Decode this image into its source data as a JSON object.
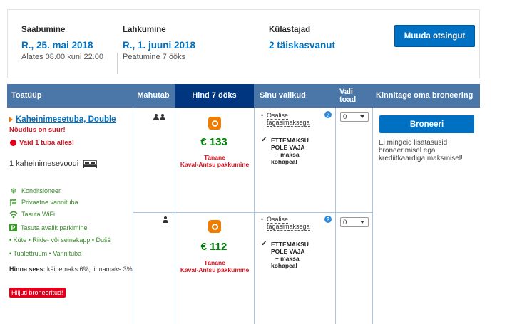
{
  "summary": {
    "checkin": {
      "label": "Saabumine",
      "value": "R., 25. mai 2018",
      "sub": "Alates 08.00 kuni 22.00"
    },
    "checkout": {
      "label": "Lahkumine",
      "value": "R., 1. juuni 2018",
      "sub": "Peatumine 7 ööks"
    },
    "guests": {
      "label": "Külastajad",
      "value": "2 täiskasvanut"
    },
    "change_button": "Muuda otsingut"
  },
  "table": {
    "headers": {
      "room_type": "Toatüüp",
      "capacity": "Mahutab",
      "price": "Hind 7 ööks",
      "choices": "Sinu valikud",
      "select_line1": "Vali",
      "select_line2": "toad",
      "confirm": "Kinnitage oma broneering"
    },
    "room": {
      "name": "Kaheinimesetuba, Double",
      "demand": "Nõudlus on suur!",
      "rooms_left": "Vaid 1 tuba alles!",
      "bed": "1 kaheinimesevoodi",
      "facilities": [
        "Konditsioneer",
        "Privaatne vannituba",
        "Tasuta WiFi",
        "Tasuta avalik parkimine"
      ],
      "amenities_line1": "• Küte • Riide- või seinakapp • Dušš",
      "amenities_line2": "• Tualettruum • Vannituba",
      "taxes_label": "Hinna sees:",
      "taxes_text": " käibemaks 6%, linnamaks 3%",
      "recent_badge": "Hiljuti broneeritud!"
    },
    "offers": [
      {
        "occupancy": 2,
        "price": "€ 133",
        "deal_line1": "Tänane",
        "deal_line2": "Kaval-Antsu pakkumine",
        "choice_line1": "Osalise",
        "choice_line2": "tagasimaksega",
        "prepay_line1": "ETTEMAKSU",
        "prepay_line2": "POLE VAJA",
        "prepay_line3": "– maksa",
        "prepay_line4": "kohapeal",
        "selected": "0"
      },
      {
        "occupancy": 1,
        "price": "€ 112",
        "deal_line1": "Tänane",
        "deal_line2": "Kaval-Antsu pakkumine",
        "choice_line1": "Osalise",
        "choice_line2": "tagasimaksega",
        "prepay_line1": "ETTEMAKSU",
        "prepay_line2": "POLE VAJA",
        "prepay_line3": "– maksa",
        "prepay_line4": "kohapeal",
        "selected": "0"
      }
    ],
    "book_button": "Broneeri",
    "book_note": "Ei mingeid lisatasusid broneerimisel ega krediitkaardiga maksmisel!"
  },
  "colors": {
    "accent": "#0071c2",
    "header": "#4b76a8",
    "price_header": "#003580",
    "price": "#008009",
    "urgent": "#d4111e",
    "deal": "#f07d00"
  }
}
